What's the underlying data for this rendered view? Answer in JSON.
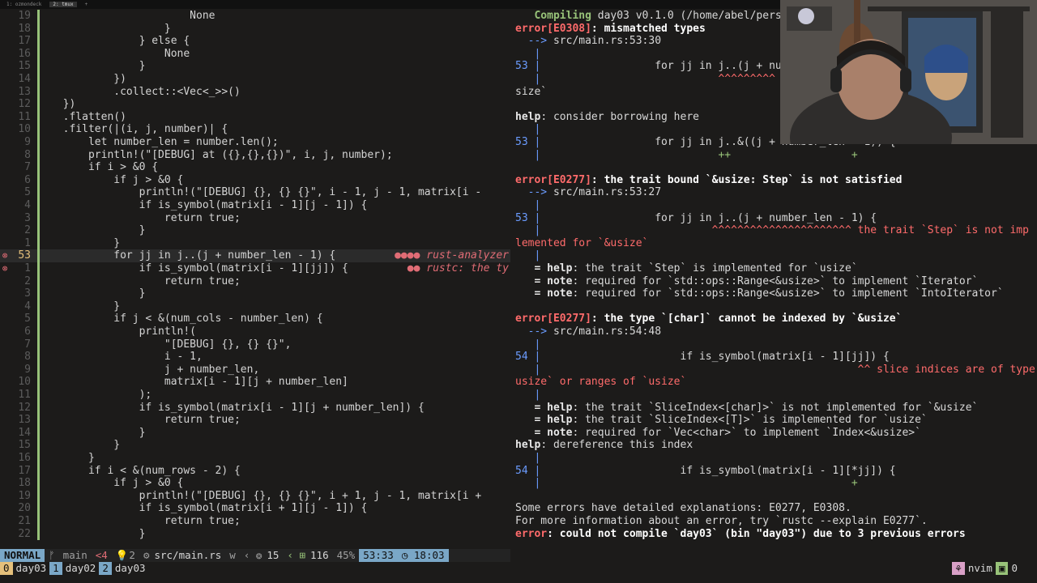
{
  "tmux_tabs": [
    {
      "label": "1: ozmondeck",
      "active": false
    },
    {
      "label": "2: tmux",
      "active": true
    },
    {
      "label": "+",
      "active": false
    }
  ],
  "editor": {
    "lines": [
      {
        "num": "19",
        "code": "                      None"
      },
      {
        "num": "18",
        "code": "                  }"
      },
      {
        "num": "17",
        "code": "              } else {"
      },
      {
        "num": "16",
        "code": "                  None"
      },
      {
        "num": "15",
        "code": "              }"
      },
      {
        "num": "14",
        "code": "          })"
      },
      {
        "num": "13",
        "code": "          .collect::<Vec<_>>()"
      },
      {
        "num": "12",
        "code": "  })"
      },
      {
        "num": "11",
        "code": "  .flatten()"
      },
      {
        "num": "10",
        "code": "  .filter(|(i, j, number)| {"
      },
      {
        "num": "9",
        "code": "      let number_len = number.len();"
      },
      {
        "num": "8",
        "code": "      println!(\"[DEBUG] at ({},{},{})\", i, j, number);"
      },
      {
        "num": "7",
        "code": "      if i > &0 {"
      },
      {
        "num": "6",
        "code": "          if j > &0 {"
      },
      {
        "num": "5",
        "code": "              println!(\"[DEBUG] {}, {} {}\", i - 1, j - 1, matrix[i -"
      },
      {
        "num": "4",
        "code": "              if is_symbol(matrix[i - 1][j - 1]) {"
      },
      {
        "num": "3",
        "code": "                  return true;"
      },
      {
        "num": "2",
        "code": "              }"
      },
      {
        "num": "1",
        "code": "          }"
      },
      {
        "num": "53",
        "code": "          for jj in j..(j + number_len - 1) {",
        "current": true,
        "diag": "●●●● rust-analyzer",
        "sign": "⊗"
      },
      {
        "num": "1",
        "code": "              if is_symbol(matrix[i - 1][jj]) {",
        "diag": "●● rustc: the ty",
        "sign": "⊗"
      },
      {
        "num": "2",
        "code": "                  return true;"
      },
      {
        "num": "3",
        "code": "              }"
      },
      {
        "num": "4",
        "code": "          }"
      },
      {
        "num": "5",
        "code": "          if j < &(num_cols - number_len) {"
      },
      {
        "num": "6",
        "code": "              println!("
      },
      {
        "num": "7",
        "code": "                  \"[DEBUG] {}, {} {}\","
      },
      {
        "num": "8",
        "code": "                  i - 1,"
      },
      {
        "num": "9",
        "code": "                  j + number_len,"
      },
      {
        "num": "10",
        "code": "                  matrix[i - 1][j + number_len]"
      },
      {
        "num": "11",
        "code": "              );"
      },
      {
        "num": "12",
        "code": "              if is_symbol(matrix[i - 1][j + number_len]) {"
      },
      {
        "num": "13",
        "code": "                  return true;"
      },
      {
        "num": "14",
        "code": "              }"
      },
      {
        "num": "15",
        "code": "          }"
      },
      {
        "num": "16",
        "code": "      }"
      },
      {
        "num": "17",
        "code": "      if i < &(num_rows - 2) {"
      },
      {
        "num": "18",
        "code": "          if j > &0 {"
      },
      {
        "num": "19",
        "code": "              println!(\"[DEBUG] {}, {} {}\", i + 1, j - 1, matrix[i +"
      },
      {
        "num": "20",
        "code": "              if is_symbol(matrix[i + 1][j - 1]) {"
      },
      {
        "num": "21",
        "code": "                  return true;"
      },
      {
        "num": "22",
        "code": "              }"
      }
    ]
  },
  "terminal": {
    "lines": [
      {
        "kind": "comp",
        "a": "   Compiling",
        "b": " day03 v0.1.0 (/home/abel/perso"
      },
      {
        "kind": "err",
        "a": "error[E0308]",
        "b": ": mismatched types"
      },
      {
        "kind": "arrow",
        "a": "  --> ",
        "b": "src/main.rs:53:30"
      },
      {
        "kind": "pipe",
        "a": "   |",
        "b": ""
      },
      {
        "kind": "src",
        "a": "53 |",
        "b": "                  for jj in j..(j + numbe"
      },
      {
        "kind": "caret",
        "a": "   |",
        "b": "                            ^^^^^^^^^"
      },
      {
        "kind": "plain",
        "a": "size`",
        "b": ""
      },
      {
        "kind": "blank",
        "a": "",
        "b": ""
      },
      {
        "kind": "help",
        "a": "help",
        "b": ": consider borrowing here"
      },
      {
        "kind": "pipe",
        "a": "   |",
        "b": ""
      },
      {
        "kind": "src",
        "a": "53 |",
        "b": "                  for jj in j..&((j + number_len - 1)) {"
      },
      {
        "kind": "plus",
        "a": "   |",
        "b": "                            ++                   +"
      },
      {
        "kind": "blank",
        "a": "",
        "b": ""
      },
      {
        "kind": "err",
        "a": "error[E0277]",
        "b": ": the trait bound `&usize: Step` is not satisfied"
      },
      {
        "kind": "arrow",
        "a": "  --> ",
        "b": "src/main.rs:53:27"
      },
      {
        "kind": "pipe",
        "a": "   |",
        "b": ""
      },
      {
        "kind": "src",
        "a": "53 |",
        "b": "                  for jj in j..(j + number_len - 1) {"
      },
      {
        "kind": "caret",
        "a": "   |",
        "b": "                           ^^^^^^^^^^^^^^^^^^^^^^ the trait `Step` is not imp"
      },
      {
        "kind": "caretcont",
        "a": "lemented for `&usize`",
        "b": ""
      },
      {
        "kind": "pipe",
        "a": "   |",
        "b": ""
      },
      {
        "kind": "help2",
        "a": "   = help",
        "b": ": the trait `Step` is implemented for `usize`"
      },
      {
        "kind": "note",
        "a": "   = note",
        "b": ": required for `std::ops::Range<&usize>` to implement `Iterator`"
      },
      {
        "kind": "note",
        "a": "   = note",
        "b": ": required for `std::ops::Range<&usize>` to implement `IntoIterator`"
      },
      {
        "kind": "blank",
        "a": "",
        "b": ""
      },
      {
        "kind": "err",
        "a": "error[E0277]",
        "b": ": the type `[char]` cannot be indexed by `&usize`"
      },
      {
        "kind": "arrow",
        "a": "  --> ",
        "b": "src/main.rs:54:48"
      },
      {
        "kind": "pipe",
        "a": "   |",
        "b": ""
      },
      {
        "kind": "src",
        "a": "54 |",
        "b": "                      if is_symbol(matrix[i - 1][jj]) {"
      },
      {
        "kind": "caret",
        "a": "   |",
        "b": "                                                  ^^ slice indices are of type `"
      },
      {
        "kind": "caretcont",
        "a": "usize` or ranges of `usize`",
        "b": ""
      },
      {
        "kind": "pipe",
        "a": "   |",
        "b": ""
      },
      {
        "kind": "help2",
        "a": "   = help",
        "b": ": the trait `SliceIndex<[char]>` is not implemented for `&usize`"
      },
      {
        "kind": "help2",
        "a": "   = help",
        "b": ": the trait `SliceIndex<[T]>` is implemented for `usize`"
      },
      {
        "kind": "note",
        "a": "   = note",
        "b": ": required for `Vec<char>` to implement `Index<&usize>`"
      },
      {
        "kind": "help",
        "a": "help",
        "b": ": dereference this index"
      },
      {
        "kind": "pipe",
        "a": "   |",
        "b": ""
      },
      {
        "kind": "src",
        "a": "54 |",
        "b": "                      if is_symbol(matrix[i - 1][*jj]) {"
      },
      {
        "kind": "plus",
        "a": "   |",
        "b": "                                                 +"
      },
      {
        "kind": "blank",
        "a": "",
        "b": ""
      },
      {
        "kind": "plain",
        "a": "Some errors have detailed explanations: E0277, E0308.",
        "b": ""
      },
      {
        "kind": "plain",
        "a": "For more information about an error, try `rustc --explain E0277`.",
        "b": ""
      },
      {
        "kind": "final",
        "a": "error",
        "b": ": could not compile `day03` (bin \"day03\") due to 3 previous errors"
      }
    ]
  },
  "statusline": {
    "mode": "NORMAL",
    "branch_icon": "git-branch-icon",
    "branch": "main",
    "diff": "<4",
    "hint_icon": "lightbulb-icon",
    "hints": "2",
    "file_icon": "file-icon",
    "file": "src/main.rs",
    "enc": "w",
    "errors_icon": "gear-icon",
    "errors": "15",
    "lines_icon": "plus-box-icon",
    "lines": "116",
    "percent": "45%",
    "position": "53:33",
    "clock_icon": "clock-icon",
    "time": "18:03"
  },
  "tmux": {
    "windows": [
      {
        "index": "0",
        "name": "day03"
      },
      {
        "index": "1",
        "name": "day02"
      },
      {
        "index": "2",
        "name": "day03"
      }
    ],
    "right_icon": "person-icon",
    "app": "nvim",
    "session_icon": "terminal-icon",
    "session": "0"
  },
  "colors": {
    "error": "#ff6b6b",
    "mode_bg": "#7aa7c7",
    "git_add": "#98c379",
    "tmux_active": "#e5c07b"
  }
}
